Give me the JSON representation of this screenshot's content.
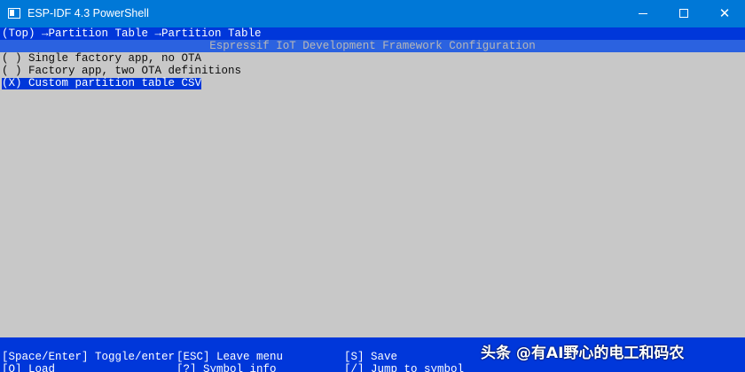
{
  "window": {
    "title": "ESP-IDF 4.3 PowerShell",
    "icon": "powershell-window-icon",
    "controls": {
      "minimize": "minimize-icon",
      "maximize": "maximize-icon",
      "close": "close-icon",
      "close_glyph": "✕"
    }
  },
  "terminal": {
    "breadcrumb": "(Top) →Partition Table →Partition Table",
    "header_title": "Espressif IoT Development Framework Configuration",
    "options": [
      {
        "text": "( ) Single factory app, no OTA",
        "selected": false
      },
      {
        "text": "( ) Factory app, two OTA definitions",
        "selected": false
      },
      {
        "text": "(X) Custom partition table CSV",
        "selected": true
      }
    ],
    "footer": {
      "row1": [
        "[Space/Enter] Toggle/enter",
        "[ESC] Leave menu",
        "[S] Save"
      ],
      "row2": [
        "[O] Load",
        "[?] Symbol info",
        "[/] Jump to symbol"
      ]
    }
  },
  "watermark": "头条 @有AI野心的电工和码农",
  "colors": {
    "titlebar": "#0078d7",
    "terminal_blue": "#0037da",
    "content_bg": "#c8c8c8",
    "header_bar": "#2b62e0",
    "text_dark": "#0c0c0c",
    "text_light": "#ffffff"
  }
}
